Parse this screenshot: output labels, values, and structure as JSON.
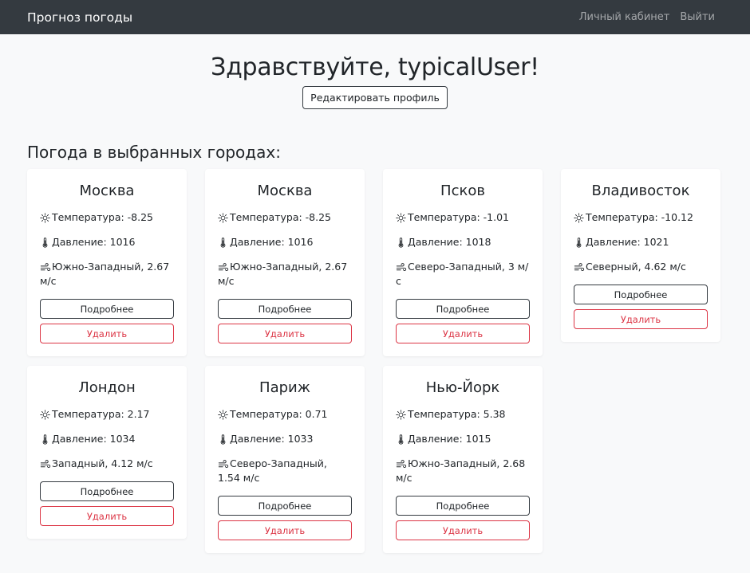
{
  "navbar": {
    "brand": "Прогноз погоды",
    "links": [
      "Личный кабинет",
      "Выйти"
    ]
  },
  "header": {
    "greeting": "Здравствуйте, typicalUser!",
    "edit_profile_label": "Редактировать профиль"
  },
  "section_title": "Погода в выбранных городах:",
  "labels": {
    "details": "Подробнее",
    "delete": "Удалить"
  },
  "icons": {
    "temperature": "sun-icon",
    "pressure": "thermometer-icon",
    "wind": "wind-icon"
  },
  "colors": {
    "navbar_bg": "#343a40",
    "page_bg": "#f8f9fa",
    "danger": "#dc3545"
  },
  "cities": [
    {
      "name": "Москва",
      "temperature": "Температура: -8.25",
      "pressure": "Давление: 1016",
      "wind": "Южно-Западный, 2.67 м/с"
    },
    {
      "name": "Москва",
      "temperature": "Температура: -8.25",
      "pressure": "Давление: 1016",
      "wind": "Южно-Западный, 2.67 м/с"
    },
    {
      "name": "Псков",
      "temperature": "Температура: -1.01",
      "pressure": "Давление: 1018",
      "wind": "Северо-Западный, 3 м/с"
    },
    {
      "name": "Владивосток",
      "temperature": "Температура: -10.12",
      "pressure": "Давление: 1021",
      "wind": "Северный, 4.62 м/с"
    },
    {
      "name": "Лондон",
      "temperature": "Температура: 2.17",
      "pressure": "Давление: 1034",
      "wind": "Западный, 4.12 м/с"
    },
    {
      "name": "Париж",
      "temperature": "Температура: 0.71",
      "pressure": "Давление: 1033",
      "wind": "Северо-Западный, 1.54 м/с"
    },
    {
      "name": "Нью-Йорк",
      "temperature": "Температура: 5.38",
      "pressure": "Давление: 1015",
      "wind": "Южно-Западный, 2.68 м/с"
    }
  ]
}
